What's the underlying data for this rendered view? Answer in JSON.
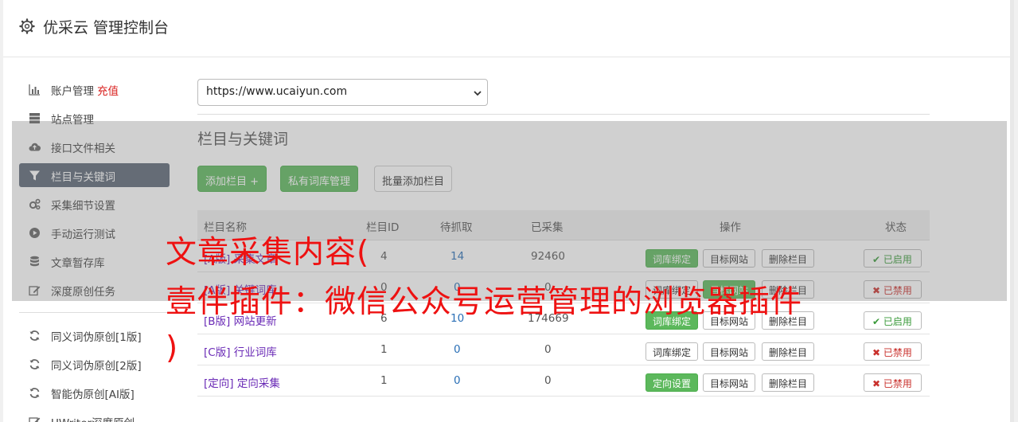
{
  "app": {
    "title": "优采云 管理控制台",
    "icon": "gear-icon"
  },
  "sidebar": {
    "items": [
      {
        "label": "账户管理",
        "extra": "充值",
        "icon": "bar-chart-icon",
        "active": false
      },
      {
        "label": "站点管理",
        "icon": "server-icon",
        "active": false
      },
      {
        "label": "接口文件相关",
        "icon": "cloud-upload-icon",
        "active": false
      },
      {
        "label": "栏目与关键词",
        "icon": "filter-icon",
        "active": true
      },
      {
        "label": "采集细节设置",
        "icon": "cogs-icon",
        "active": false
      },
      {
        "label": "手动运行测试",
        "icon": "play-circle-icon",
        "active": false
      },
      {
        "label": "文章暂存库",
        "icon": "database-icon",
        "active": false
      },
      {
        "label": "深度原创任务",
        "icon": "edit-icon",
        "active": false
      }
    ],
    "tools": [
      {
        "label": "同义词伪原创[1版]",
        "icon": "refresh-icon"
      },
      {
        "label": "同义词伪原创[2版]",
        "icon": "refresh-icon"
      },
      {
        "label": "智能伪原创[AI版]",
        "icon": "refresh-icon"
      },
      {
        "label": "UWriter深度原创",
        "icon": "edit-icon"
      }
    ]
  },
  "site_select": {
    "value": "https://www.ucaiyun.com"
  },
  "section": {
    "title": "栏目与关键词",
    "add_button": "添加栏目 +",
    "private_lib_button": "私有词库管理",
    "batch_add_button": "批量添加栏目"
  },
  "table": {
    "headers": {
      "name": "栏目名称",
      "id": "栏目ID",
      "pending": "待抓取",
      "collected": "已采集",
      "ops": "操作",
      "status": "状态"
    },
    "rows": [
      {
        "tag": "[A版]",
        "name": "采集文章",
        "id": "4",
        "pending": "14",
        "collected": "92460",
        "op1": "词库绑定",
        "op1_green": true,
        "op2": "目标网站",
        "op3": "删除栏目",
        "status": "已启用",
        "enabled": true
      },
      {
        "tag": "[A版]",
        "name": "关键词库",
        "id": "0",
        "pending": "0",
        "collected": "0",
        "op1": "词库绑定",
        "op1_green": false,
        "op2": "目标网站",
        "op3": "删除栏目",
        "status": "已禁用",
        "enabled": false
      },
      {
        "tag": "[B版]",
        "name": "网站更新",
        "id": "6",
        "pending": "10",
        "collected": "174669",
        "op1": "词库绑定",
        "op1_green": true,
        "op2": "目标网站",
        "op3": "删除栏目",
        "status": "已启用",
        "enabled": true
      },
      {
        "tag": "[C版]",
        "name": "行业词库",
        "id": "1",
        "pending": "0",
        "collected": "0",
        "op1": "词库绑定",
        "op1_green": false,
        "op2": "目标网站",
        "op3": "删除栏目",
        "status": "已禁用",
        "enabled": false
      },
      {
        "tag": "[定向]",
        "name": "定向采集",
        "id": "1",
        "pending": "0",
        "collected": "0",
        "op1": "定向设置",
        "op1_green": true,
        "op2": "目标网站",
        "op3": "删除栏目",
        "status": "已禁用",
        "enabled": false
      }
    ]
  },
  "watermark": {
    "line1": "文章采集内容(",
    "line2": "壹伴插件：微信公众号运营管理的浏览器插件",
    "line3": ")"
  },
  "colors": {
    "accent_green": "#5cb85c",
    "nav_active": "#5b6675",
    "watermark_red": "#ee1111",
    "link_purple": "#6a2ab6",
    "number_blue": "#2a6fb6"
  }
}
